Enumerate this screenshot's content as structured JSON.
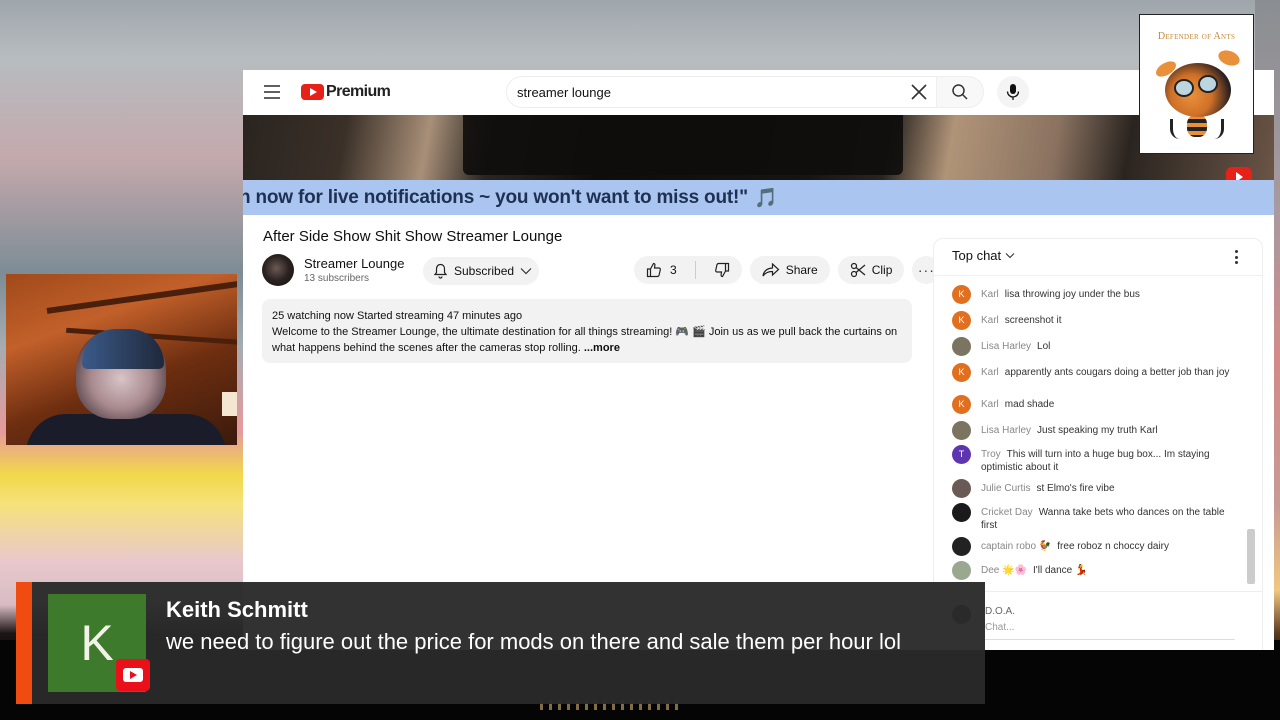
{
  "youtube": {
    "brand": "Premium",
    "search": {
      "value": "streamer lounge",
      "placeholder": "Search"
    },
    "icons": [
      "menu-icon",
      "youtube-logo-icon",
      "clear-icon",
      "search-icon",
      "microphone-icon"
    ],
    "ticker_text": "n now for live notifications ~ you won't want to miss out!\"",
    "ticker_emoji": "🎵",
    "video": {
      "title": "After Side Show Shit Show Streamer Lounge",
      "channel": {
        "name": "Streamer Lounge",
        "subscribers": "13 subscribers"
      },
      "subscribe_label": "Subscribed",
      "likes": "3",
      "share_label": "Share",
      "clip_label": "Clip",
      "more_label": "···",
      "description": {
        "stats": "25 watching now  Started streaming 47 minutes ago",
        "text": "Welcome to the Streamer Lounge, the ultimate destination for all things streaming! 🎮 🎬 Join us as we pull back the curtains on what happens behind the scenes after the cameras stop rolling.",
        "more_label": "...more"
      }
    },
    "chat": {
      "header": "Top chat",
      "messages": [
        {
          "author": "Karl",
          "text": "lisa throwing joy under the bus",
          "initial": "K",
          "color": "#e0701f"
        },
        {
          "author": "Karl",
          "text": "screenshot it",
          "initial": "K",
          "color": "#e0701f"
        },
        {
          "author": "Lisa Harley",
          "text": "Lol",
          "initial": "",
          "color": "#7a7460"
        },
        {
          "author": "Karl",
          "text": "apparently ants cougars doing a better job than joy",
          "initial": "K",
          "color": "#e0701f"
        },
        {
          "author": "Karl",
          "text": "mad shade",
          "initial": "K",
          "color": "#e0701f"
        },
        {
          "author": "Lisa Harley",
          "text": "Just speaking my truth Karl",
          "initial": "",
          "color": "#7a7460"
        },
        {
          "author": "Troy",
          "text": "This will turn into a huge bug box... Im staying optimistic about it",
          "initial": "T",
          "color": "#5e35b1"
        },
        {
          "author": "Julie Curtis",
          "text": "st Elmo's fire vibe",
          "initial": "",
          "color": "#6a5a55"
        },
        {
          "author": "Cricket Day",
          "text": "Wanna take bets who dances on the table first",
          "initial": "",
          "color": "#1a1a1a"
        },
        {
          "author": "captain robo 🐓",
          "text": "free roboz n choccy dairy",
          "initial": "",
          "color": "#222222"
        },
        {
          "author": "Dee 🌟🌸",
          "text": "I'll dance 💃",
          "initial": "",
          "color": "#9aa890"
        }
      ],
      "input": {
        "user": "D.O.A.",
        "placeholder": "Chat..."
      }
    }
  },
  "overlay": {
    "logo_text": "Defender of Ants",
    "notification": {
      "initial": "K",
      "name": "Keith Schmitt",
      "message": "we need to figure out the price for mods on there and sale them per hour lol",
      "accent": "#f04c12",
      "avatar_color": "#3e7a2c"
    }
  }
}
